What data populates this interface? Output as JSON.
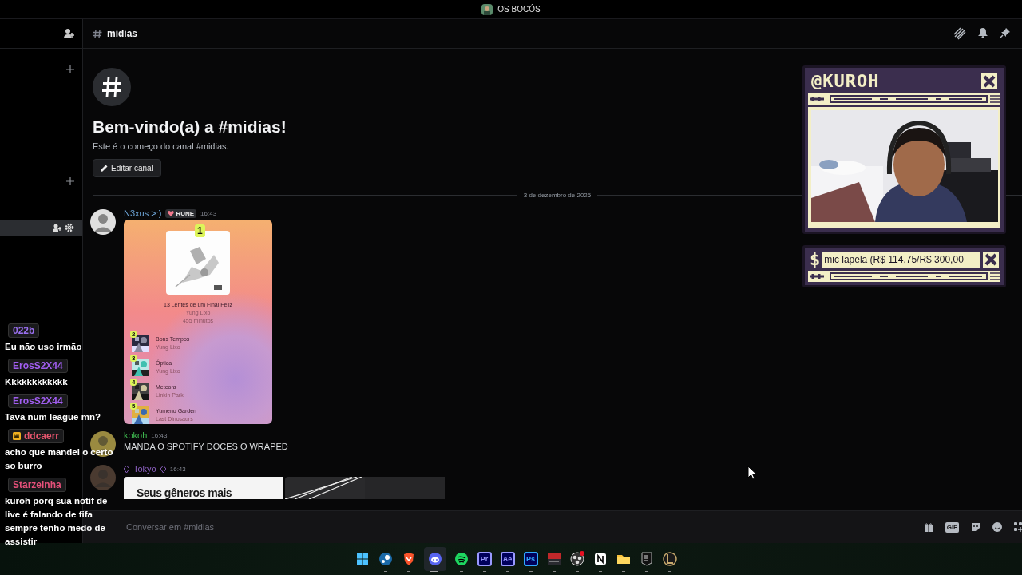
{
  "server": {
    "name": "OS BOCÓS"
  },
  "sidebar": {
    "rows": [
      {
        "kind": "add",
        "selected": false
      },
      {
        "kind": "add",
        "selected": false
      },
      {
        "kind": "channel",
        "selected": true
      }
    ]
  },
  "channel": {
    "name": "midias",
    "welcome_title": "Bem-vindo(a) a #midias!",
    "welcome_text": "Este é o começo do canal #midias.",
    "edit_button": "Editar canal"
  },
  "date_divider": "3 de dezembro de 2025",
  "messages": [
    {
      "author": "N3xus >:)",
      "color": "#6fa8dc",
      "tag": "RUNE",
      "time": "16:43",
      "attachment": {
        "kind": "wrapped",
        "top": {
          "rank": "1",
          "title": "13 Lentes de um Final Feliz",
          "artist": "Yung Lixo",
          "minutes": "455 minutos"
        },
        "tracks": [
          {
            "rank": "2",
            "title": "Bons Tempos",
            "artist": "Yung Lixo"
          },
          {
            "rank": "3",
            "title": "Óptica",
            "artist": "Yung Lixo"
          },
          {
            "rank": "4",
            "title": "Meteora",
            "artist": "Linkin Park"
          },
          {
            "rank": "5",
            "title": "Yumeno Garden",
            "artist": "Last Dinosaurs"
          }
        ]
      }
    },
    {
      "author": "kokoh",
      "color": "#3fb950",
      "time": "16:43",
      "text": "MANDA O SPOTIFY DOCES O WRAPED"
    },
    {
      "author": "Tokyo",
      "color": "#8b5fbf",
      "role_icons": true,
      "time": "16:43",
      "attachment": {
        "kind": "genres",
        "heading": "Seus gêneros mais"
      }
    }
  ],
  "composer": {
    "placeholder": "Conversar em #midias",
    "gif": "GIF"
  },
  "stream_chat": [
    {
      "user": "022b",
      "color": "#9a70f0",
      "text": "Eu não uso irmão"
    },
    {
      "user": "ErosS2X44",
      "color": "#a15ef0",
      "text": "Kkkkkkkkkkkk"
    },
    {
      "user": "ErosS2X44",
      "color": "#a15ef0",
      "text": "Tava num league mn?"
    },
    {
      "user": "ddcaerr",
      "color": "#e8566e",
      "crown": true,
      "text": "acho que mandei o certo so burro"
    },
    {
      "user": "Starzeinha",
      "color": "#e5507a",
      "text": "kuroh porq sua notif de live é falando de fifa sempre tenho medo de assistir"
    }
  ],
  "cam": {
    "handle": "@KUROH"
  },
  "goal": {
    "symbol": "$",
    "text": "mic lapela (R$ 114,75/R$ 300,00"
  },
  "taskbar": [
    {
      "kind": "start",
      "selected": false
    },
    {
      "kind": "steam",
      "selected": false
    },
    {
      "kind": "brave",
      "selected": false
    },
    {
      "kind": "discord",
      "selected": true
    },
    {
      "kind": "spotify",
      "selected": false
    },
    {
      "kind": "app",
      "label": "Pr",
      "color": "#9999ff",
      "selected": false
    },
    {
      "kind": "app",
      "label": "Ae",
      "color": "#9999ff",
      "selected": false
    },
    {
      "kind": "app",
      "label": "Ps",
      "color": "#31a8ff",
      "selected": false
    },
    {
      "kind": "voicemeeter",
      "selected": false
    },
    {
      "kind": "obs",
      "selected": false
    },
    {
      "kind": "notion",
      "selected": false
    },
    {
      "kind": "folder",
      "selected": false
    },
    {
      "kind": "epic",
      "selected": false
    },
    {
      "kind": "league",
      "selected": false
    }
  ]
}
